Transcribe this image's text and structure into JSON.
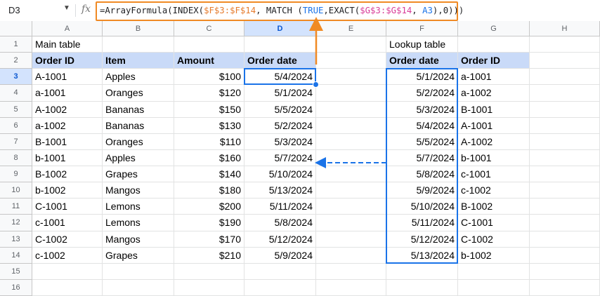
{
  "namebox": {
    "value": "D3"
  },
  "formula": {
    "fx_label": "fx",
    "p1": "=ArrayFormula(INDEX(",
    "p2": "$F$3:$F$14",
    "p3": ", MATCH (",
    "p4": "TRUE",
    "p5": ",EXACT(",
    "p6": "$G$3:$G$14",
    "p7": ", ",
    "p8": "A3",
    "p9": "),0)))"
  },
  "columns": [
    "A",
    "B",
    "C",
    "D",
    "E",
    "F",
    "G",
    "H"
  ],
  "selected_column": "D",
  "rows": [
    "1",
    "2",
    "3",
    "4",
    "5",
    "6",
    "7",
    "8",
    "9",
    "10",
    "11",
    "12",
    "13",
    "14",
    "15",
    "16"
  ],
  "selected_row": "3",
  "main_table": {
    "title": "Main table",
    "headers": [
      "Order ID",
      "Item",
      "Amount",
      "Order date"
    ],
    "data": [
      [
        "A-1001",
        "Apples",
        "$100",
        "5/4/2024"
      ],
      [
        "a-1001",
        "Oranges",
        "$120",
        "5/1/2024"
      ],
      [
        "A-1002",
        "Bananas",
        "$150",
        "5/5/2024"
      ],
      [
        "a-1002",
        "Bananas",
        "$130",
        "5/2/2024"
      ],
      [
        "B-1001",
        "Oranges",
        "$110",
        "5/3/2024"
      ],
      [
        "b-1001",
        "Apples",
        "$160",
        "5/7/2024"
      ],
      [
        "B-1002",
        "Grapes",
        "$140",
        "5/10/2024"
      ],
      [
        "b-1002",
        "Mangos",
        "$180",
        "5/13/2024"
      ],
      [
        "C-1001",
        "Lemons",
        "$200",
        "5/11/2024"
      ],
      [
        "c-1001",
        "Lemons",
        "$190",
        "5/8/2024"
      ],
      [
        "C-1002",
        "Mangos",
        "$170",
        "5/12/2024"
      ],
      [
        "c-1002",
        "Grapes",
        "$210",
        "5/9/2024"
      ]
    ]
  },
  "lookup_table": {
    "title": "Lookup table",
    "headers": [
      "Order date",
      "Order ID"
    ],
    "data": [
      [
        "5/1/2024",
        "a-1001"
      ],
      [
        "5/2/2024",
        "a-1002"
      ],
      [
        "5/3/2024",
        "B-1001"
      ],
      [
        "5/4/2024",
        "A-1001"
      ],
      [
        "5/5/2024",
        "A-1002"
      ],
      [
        "5/7/2024",
        "b-1001"
      ],
      [
        "5/8/2024",
        "c-1001"
      ],
      [
        "5/9/2024",
        "c-1002"
      ],
      [
        "5/10/2024",
        "B-1002"
      ],
      [
        "5/11/2024",
        "C-1001"
      ],
      [
        "5/12/2024",
        "C-1002"
      ],
      [
        "5/13/2024",
        "b-1002"
      ]
    ]
  },
  "colors": {
    "header_fill": "#c9daf8",
    "selection": "#1a73e8",
    "formula_border": "#f08a24",
    "arrow_orange": "#f08a24",
    "arrow_blue": "#1a73e8"
  }
}
